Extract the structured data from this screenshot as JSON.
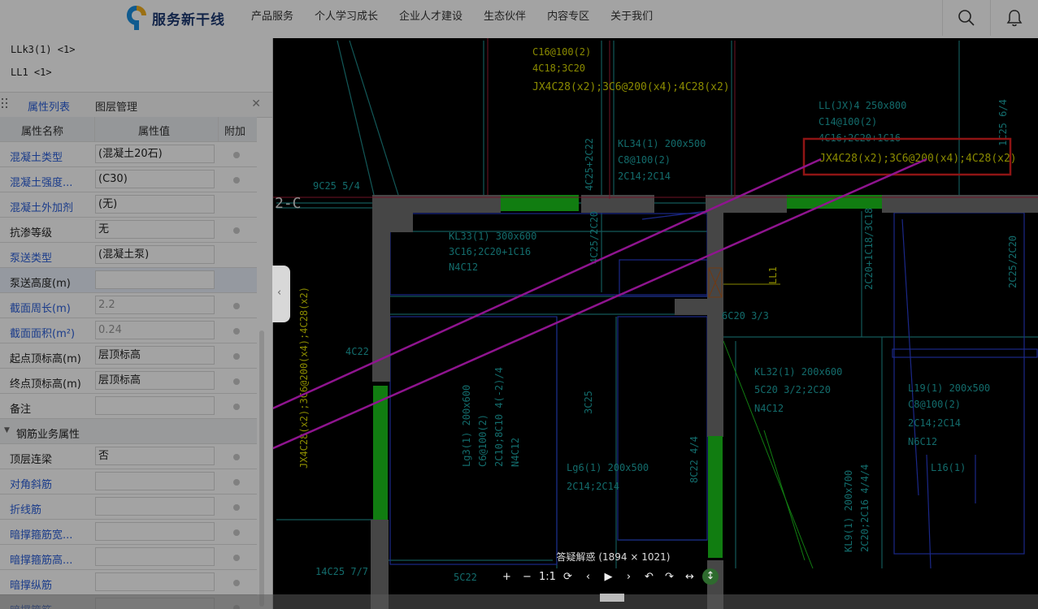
{
  "header": {
    "brand": "服务新干线",
    "nav": [
      "产品服务",
      "个人学习成长",
      "企业人才建设",
      "生态伙伴",
      "内容专区",
      "关于我们"
    ]
  },
  "beam_list": [
    "LLk3(1) <1>",
    "LL1 <1>"
  ],
  "panel": {
    "tab_properties": "属性列表",
    "tab_layers": "图层管理",
    "col_name": "属性名称",
    "col_value": "属性值",
    "col_extra": "附加",
    "rows": [
      {
        "name": "混凝土类型",
        "value": "(混凝土20石)",
        "blue": true,
        "dot": true
      },
      {
        "name": "混凝土强度...",
        "value": "(C30)",
        "blue": true,
        "dot": true
      },
      {
        "name": "混凝土外加剂",
        "value": "(无)",
        "blue": true,
        "dot": false
      },
      {
        "name": "抗渗等级",
        "value": "无",
        "blue": false,
        "dot": true
      },
      {
        "name": "泵送类型",
        "value": "(混凝土泵)",
        "blue": true,
        "dot": false
      },
      {
        "name": "泵送高度(m)",
        "value": "",
        "blue": false,
        "dot": false,
        "hl": true
      },
      {
        "name": "截面周长(m)",
        "value": "2.2",
        "blue": true,
        "dot": true,
        "gray": true
      },
      {
        "name": "截面面积(m²)",
        "value": "0.24",
        "blue": true,
        "dot": true,
        "gray": true
      },
      {
        "name": "起点顶标高(m)",
        "value": "层顶标高",
        "blue": false,
        "dot": true
      },
      {
        "name": "终点顶标高(m)",
        "value": "层顶标高",
        "blue": false,
        "dot": true
      },
      {
        "name": "备注",
        "value": "",
        "blue": false,
        "dot": true
      }
    ],
    "section": "钢筋业务属性",
    "rows2": [
      {
        "name": "顶层连梁",
        "value": "否",
        "blue": false,
        "dot": true
      },
      {
        "name": "对角斜筋",
        "value": "",
        "blue": true,
        "dot": true
      },
      {
        "name": "折线筋",
        "value": "",
        "blue": true,
        "dot": true
      },
      {
        "name": "暗撑箍筋宽...",
        "value": "",
        "blue": true,
        "dot": true
      },
      {
        "name": "暗撑箍筋高...",
        "value": "",
        "blue": true,
        "dot": true
      },
      {
        "name": "暗撑纵筋",
        "value": "",
        "blue": true,
        "dot": true
      },
      {
        "name": "暗撑箍筋",
        "value": "",
        "blue": true,
        "dot": true
      }
    ]
  },
  "drawing": {
    "labels": {
      "l_c16": "C16@100(2)",
      "l_4c18": "4C18;3C20",
      "l_jx_top": "JX4C28(x2);3C6@200(x4);4C28(x2)",
      "l_ll": "LL(JX)4 250x800",
      "l_c14": "C14@100(2)",
      "l_4c16": "4C16;2C20+1C16",
      "l_jx_hl": "JX4C28(x2);3C6@200(x4);4C28(x2)",
      "l_kl34": "KL34(1) 200x500",
      "l_c8": "C8@100(2)",
      "l_2c14": "2C14;2C14",
      "l_9c25": "9C25 5/4",
      "l_2c": "2-C",
      "l_kl33": "KL33(1) 300x600",
      "l_3c16": "3C16;2C20+1C16",
      "l_n4c12": "N4C12",
      "l_ll1": "LL1",
      "l_6c20": "6C20 3/3",
      "l_4c22": "4C22",
      "l_kl32": "KL32(1) 200x600",
      "l_5c20": "5C20 3/2;2C20",
      "l_n4c12b": "N4C12",
      "l_l19": "L19(1) 200x500",
      "l_c8b": "C8@100(2)",
      "l_2c14b": "2C14;2C14",
      "l_n6c12": "N6C12",
      "l_l16": "L16(1)",
      "l_lg3": "Lg3(1) 200x600",
      "l_c6": "C6@100(2)",
      "l_2c10": "2C10;8C10 4(-2)/4",
      "l_n4c12c": "N4C12",
      "l_lg6": "Lg6(1) 200x500",
      "l_2c14c": "2C14;2C14",
      "l_14c25": "14C25 7/7",
      "l_5c22": "5C22",
      "l_kl9": "KL9(1) 200x700",
      "l_2c20": "2C20;2C16 4/4/4",
      "l_vert_jx": "JX4C28(x2);3C6@200(x4);4C28(x2)",
      "l_8c22": "8C22 4/4",
      "l_3c25": "3C25",
      "l_4c25": "4C25/2C20",
      "l_2c25": "2C25/2C20",
      "l_2c20b": "2C20+1C18/3C18",
      "l_4c22b": "4C25+2C22",
      "l_1c25": "1C25 6/4"
    }
  },
  "viewer": {
    "title": "答疑解惑 (1894 × 1021)",
    "tools": [
      "+",
      "−",
      "1:1",
      "⟳",
      "‹",
      "▶",
      "›",
      "↶",
      "↷",
      "↔",
      "↕"
    ]
  }
}
